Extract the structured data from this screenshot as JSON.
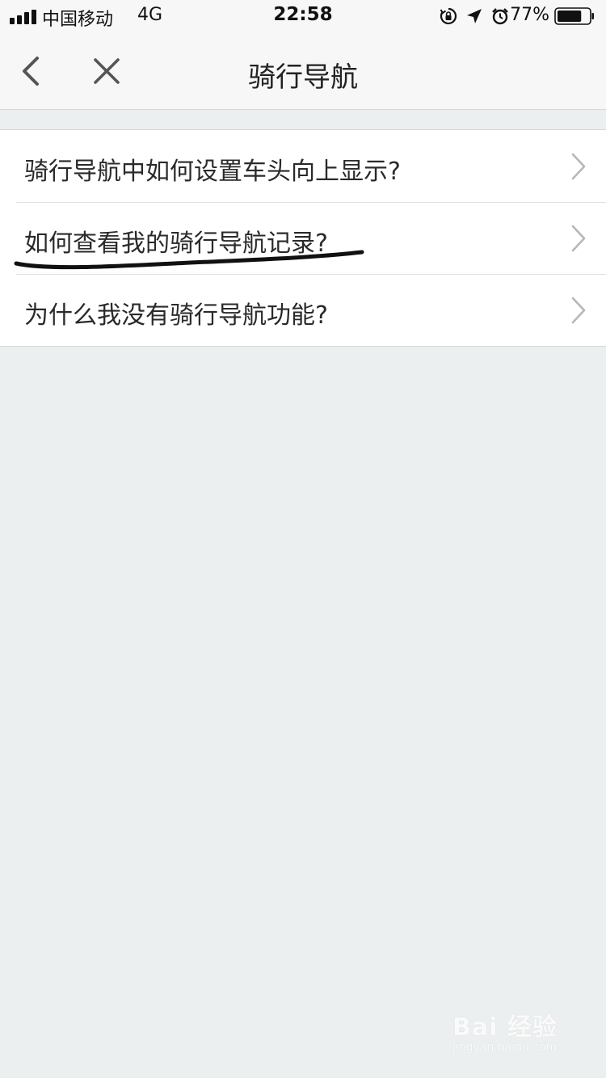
{
  "status_bar": {
    "carrier": "中国移动",
    "network": "4G",
    "time": "22:58",
    "battery_percent": "77%",
    "battery_level": 0.77,
    "icons": [
      "orientation-lock-icon",
      "location-arrow-icon",
      "alarm-clock-icon"
    ]
  },
  "nav": {
    "title": "骑行导航"
  },
  "list": {
    "items": [
      {
        "label": "骑行导航中如何设置车头向上显示?"
      },
      {
        "label": "如何查看我的骑行导航记录?"
      },
      {
        "label": "为什么我没有骑行导航功能?"
      }
    ]
  },
  "watermark": {
    "logo": "Bai 经验",
    "domain": "jingyan.baidu.com"
  },
  "colors": {
    "background": "#ebeff0",
    "bar": "#f7f7f7",
    "annotation": "#111111"
  }
}
